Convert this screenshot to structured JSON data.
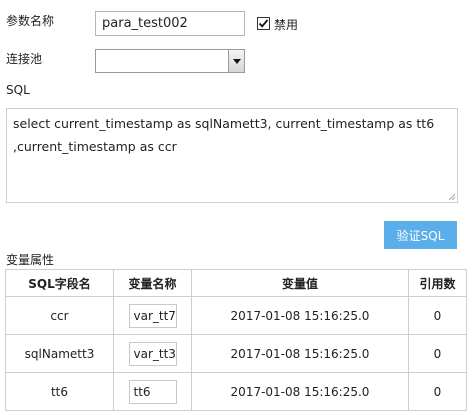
{
  "form": {
    "param_name_label": "参数名称",
    "param_name_value": "para_test002",
    "disabled_label": "禁用",
    "disabled_checked": true,
    "pool_label": "连接池",
    "pool_value": "",
    "sql_label": "SQL",
    "sql_text": "select current_timestamp as sqlNamett3, current_timestamp as tt6 ,current_timestamp as ccr",
    "validate_button": "验证SQL"
  },
  "variables": {
    "section_label": "变量属性",
    "headers": [
      "SQL字段名",
      "变量名称",
      "变量值",
      "引用数"
    ],
    "rows": [
      {
        "field": "ccr",
        "name": "var_tt7",
        "value": "2017-01-08 15:16:25.0",
        "refs": "0"
      },
      {
        "field": "sqlNamett3",
        "name": "var_tt3",
        "value": "2017-01-08 15:16:25.0",
        "refs": "0"
      },
      {
        "field": "tt6",
        "name": "tt6",
        "value": "2017-01-08 15:16:25.0",
        "refs": "0"
      }
    ]
  },
  "colors": {
    "accent": "#5aaee9",
    "border": "#cfcfcf"
  },
  "icons": {
    "checkbox": "checkmark-icon",
    "dropdown": "triangle-down-icon"
  }
}
